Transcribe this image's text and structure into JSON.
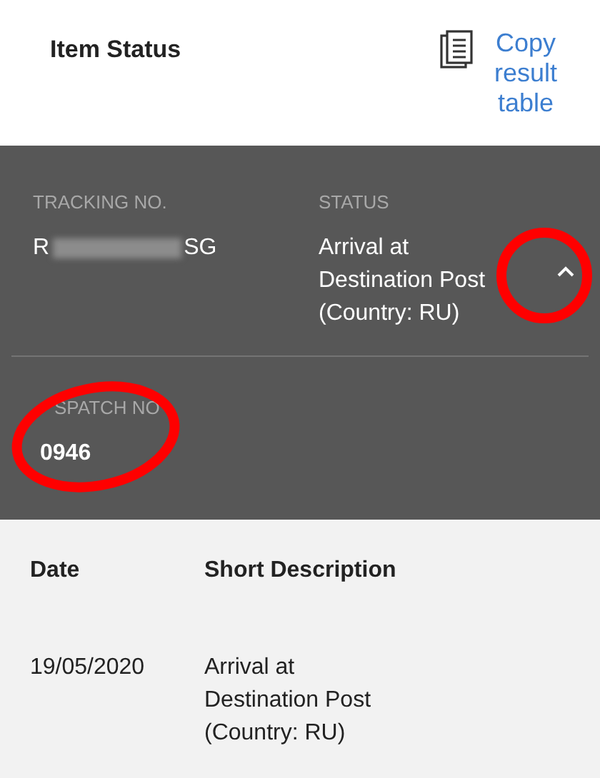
{
  "header": {
    "title": "Item Status",
    "copy_link": [
      "Copy",
      "result",
      "table"
    ]
  },
  "details": {
    "tracking": {
      "label": "TRACKING NO.",
      "value_start": "R",
      "value_end": "SG"
    },
    "status": {
      "label": "STATUS",
      "value": [
        "Arrival at",
        "Destination Post",
        "(Country: RU)"
      ],
      "expanded": true
    },
    "dispatch": {
      "label": "SPATCH NO",
      "value": "0946"
    }
  },
  "table": {
    "columns": [
      "Date",
      "Short Description"
    ],
    "rows": [
      {
        "date": "19/05/2020",
        "description": [
          "Arrival at",
          "Destination Post",
          "(Country: RU)"
        ]
      }
    ]
  }
}
